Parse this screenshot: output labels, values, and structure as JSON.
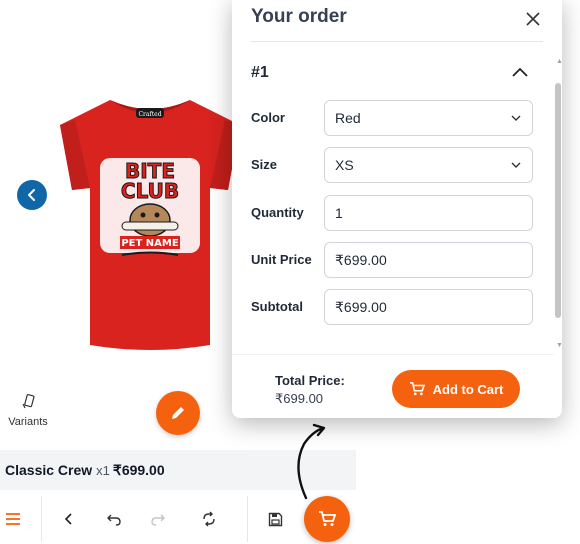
{
  "product": {
    "image_alt": "Red t-shirt with Bite Club print",
    "print_title_line1": "BITE",
    "print_title_line2": "CLUB",
    "print_name": "PET NAME",
    "tag": "Crafted"
  },
  "variants": {
    "label": "Variants",
    "icon": "variants-icon"
  },
  "summary": {
    "name": "Classic Crew",
    "qty": "x1",
    "price": "₹699.00"
  },
  "order_panel": {
    "title": "Your order",
    "item_number": "#1",
    "fields": {
      "color": {
        "label": "Color",
        "value": "Red"
      },
      "size": {
        "label": "Size",
        "value": "XS"
      },
      "quantity": {
        "label": "Quantity",
        "value": "1"
      },
      "unit_price": {
        "label": "Unit Price",
        "value": "₹699.00"
      },
      "subtotal": {
        "label": "Subtotal",
        "value": "₹699.00"
      }
    },
    "total_label": "Total Price:",
    "total_value": "₹699.00",
    "add_to_cart": "Add to Cart"
  },
  "colors": {
    "accent": "#f5620f",
    "nav_blue": "#0f67a8",
    "summary_bg": "#f3f4f6"
  }
}
